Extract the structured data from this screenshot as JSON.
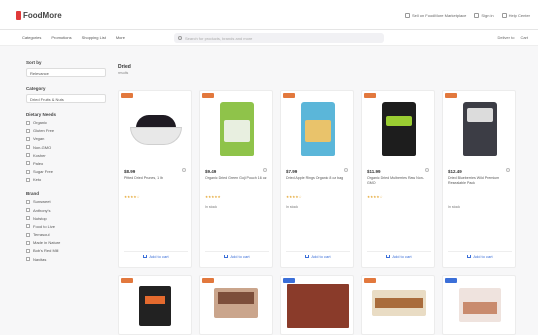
{
  "header": {
    "logo": "FoodMore",
    "links": [
      "Sell on FoodMore Marketplace",
      "Sign in",
      "Help Center"
    ]
  },
  "nav": {
    "items": [
      "Categories",
      "Promotions",
      "Shopping List",
      "More"
    ],
    "search_placeholder": "Search for products, brands and more",
    "right": [
      "Deliver to",
      "Cart"
    ]
  },
  "sidebar": {
    "sort": {
      "title": "Sort by",
      "value": "Relevance"
    },
    "category": {
      "title": "Category",
      "value": "Dried Fruits & Nuts"
    },
    "diet_title": "Dietary Needs",
    "diet_options": [
      "Organic",
      "Gluten Free",
      "Vegan",
      "Non-GMO",
      "Kosher",
      "Paleo",
      "Sugar Free",
      "Keto"
    ],
    "brand_title": "Brand",
    "brand_options": [
      "Sunsweet",
      "Anthony's",
      "Nutstop",
      "Food to Live",
      "Terrasoul",
      "Made in Nature",
      "Bob's Red Mill",
      "Navitas"
    ]
  },
  "results": {
    "title": "Dried",
    "subtitle": "results"
  },
  "products": [
    {
      "price": "$8.99",
      "name": "Pitted Dried Prunes, 1 lb",
      "rating": "★★★★☆",
      "stock": "",
      "add_label": "Add to cart",
      "badge_color": "#e2783d"
    },
    {
      "price": "$9.49",
      "name": "Organic Dried Green Goji Pouch 16 oz",
      "rating": "★★★★★",
      "stock": "In stock",
      "add_label": "Add to cart",
      "badge_color": "#e2783d"
    },
    {
      "price": "$7.99",
      "name": "Dried Apple Rings Organic 8 oz bag",
      "rating": "★★★★☆",
      "stock": "In stock",
      "add_label": "Add to cart",
      "badge_color": "#e2783d"
    },
    {
      "price": "$11.99",
      "name": "Organic Dried Mulberries Raw Non-GMO",
      "rating": "★★★★☆",
      "stock": "",
      "add_label": "Add to cart",
      "badge_color": "#e2783d"
    },
    {
      "price": "$12.49",
      "name": "Dried Blueberries Wild Premium Resealable Pack",
      "rating": "",
      "stock": "In stock",
      "add_label": "Add to cart",
      "badge_color": "#e2783d"
    }
  ],
  "products_row2_badges": [
    "#e2783d",
    "#e2783d",
    "#3b6fd8",
    "#e2783d",
    "#3b6fd8"
  ]
}
